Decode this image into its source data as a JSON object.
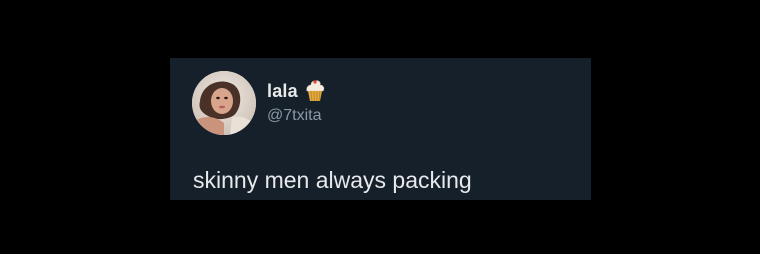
{
  "tweet": {
    "display_name": "lala",
    "handle": "@7txita",
    "text": "skinny men always packing",
    "name_badge_icon": "cupcake-icon"
  },
  "colors": {
    "page_background": "#000000",
    "card_background": "#15202b",
    "primary_text": "#e7e9ea",
    "secondary_text": "#8b98a5"
  }
}
